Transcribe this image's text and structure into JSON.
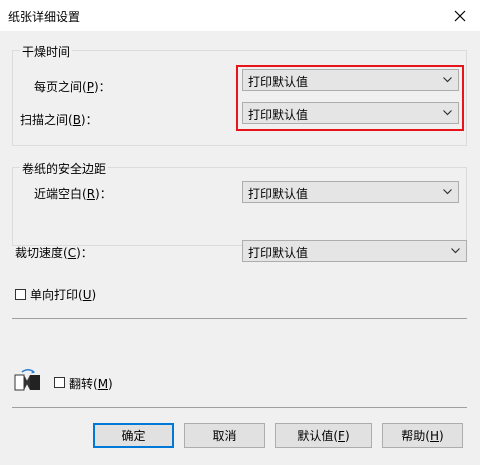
{
  "window": {
    "title": "纸张详细设置",
    "close_glyph": "✕"
  },
  "dry_time_group": {
    "title": "干燥时间",
    "between_pages": {
      "label": "每页之间(",
      "key": "P",
      "suffix": ")：",
      "value": "打印默认值"
    },
    "between_scans": {
      "label": "扫描之间(",
      "key": "B",
      "suffix": ")：",
      "value": "打印默认值"
    }
  },
  "margin_group": {
    "title": "卷纸的安全边距",
    "near_margin": {
      "label": "近端空白(",
      "key": "R",
      "suffix": ")：",
      "value": "打印默认值"
    }
  },
  "cut_speed": {
    "label": "裁切速度(",
    "key": "C",
    "suffix": ")：",
    "value": "打印默认值"
  },
  "unidirectional": {
    "label": "单向打印(",
    "key": "U",
    "suffix": ")",
    "checked": false
  },
  "flip": {
    "label": "翻转(",
    "key": "M",
    "suffix": ")",
    "checked": false,
    "icon": "flip-page-icon"
  },
  "buttons": {
    "ok": "确定",
    "cancel": "取消",
    "defaults_label": "默认值(",
    "defaults_key": "F",
    "defaults_suffix": ")",
    "help_label": "帮助(",
    "help_key": "H",
    "help_suffix": ")"
  },
  "colors": {
    "highlight": "#e8141a",
    "default_button_border": "#0078d7"
  }
}
